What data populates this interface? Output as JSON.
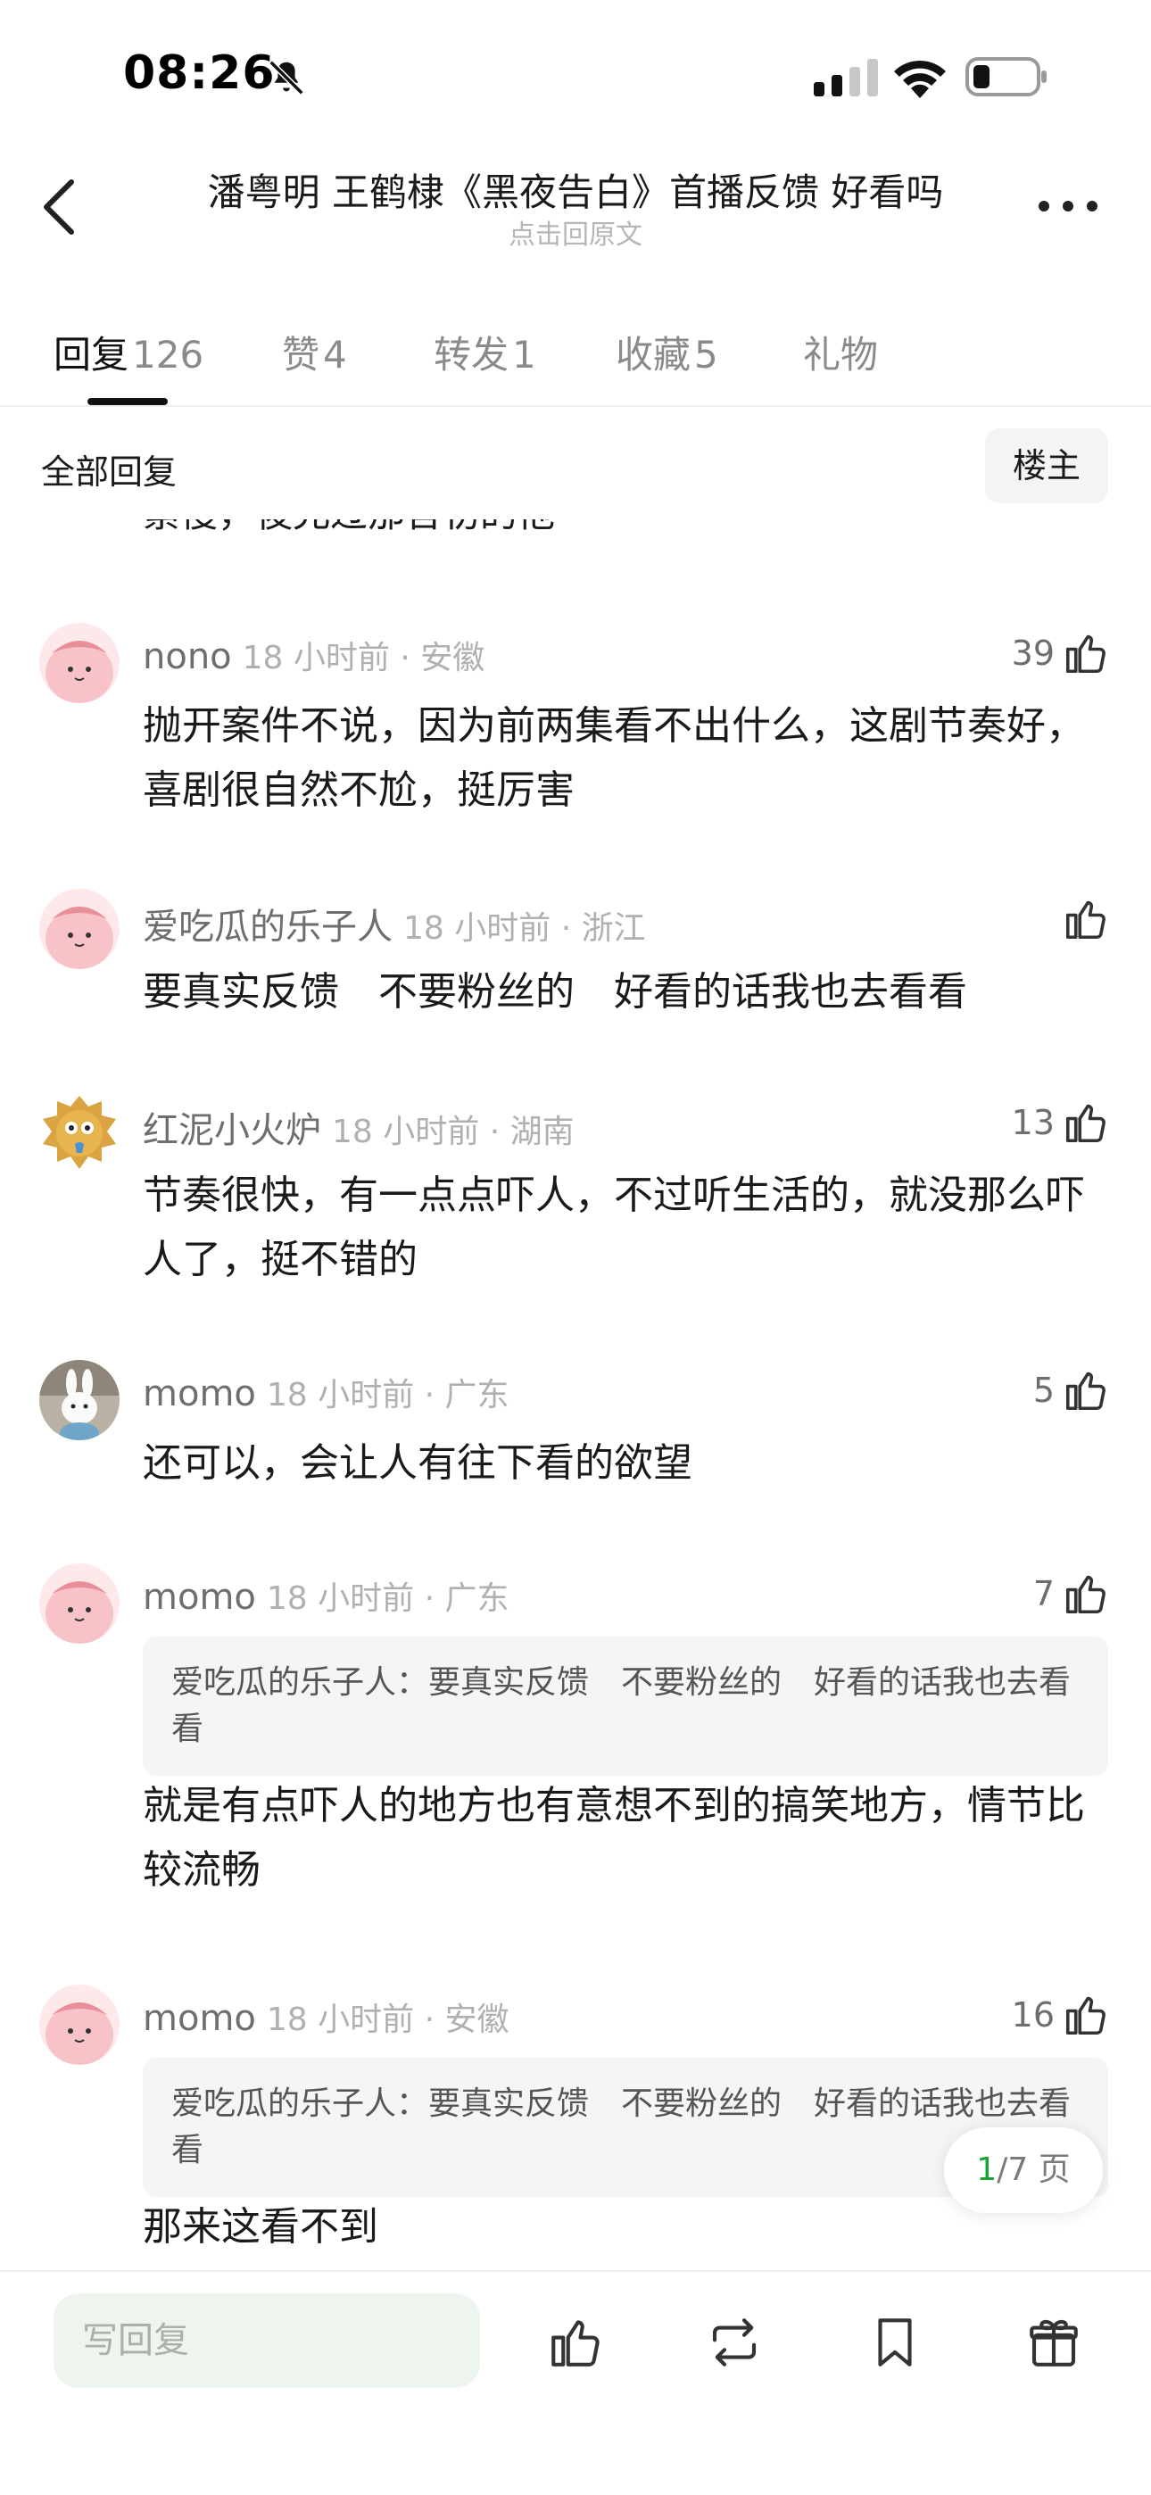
{
  "status": {
    "time": "08:26"
  },
  "nav": {
    "title": "潘粤明 王鹤棣《黑夜告白》首播反馈 好看吗",
    "subtitle": "点击回原文"
  },
  "tabs": [
    {
      "label": "回复",
      "count": "126"
    },
    {
      "label": "赞",
      "count": "4"
    },
    {
      "label": "转发",
      "count": "1"
    },
    {
      "label": "收藏",
      "count": "5"
    },
    {
      "label": "礼物",
      "count": ""
    }
  ],
  "filter": {
    "label": "全部回复",
    "owner_button": "楼主"
  },
  "cut_text": "累慢，後允过那舍初的他",
  "comments": [
    {
      "name": "nono",
      "meta": "18 小时前 · 安徽",
      "likes": "39",
      "quote": "",
      "body": "抛开案件不说，因为前两集看不出什么，这剧节奏好，喜剧很自然不尬，挺厉害",
      "avatar": "pink-cartoon"
    },
    {
      "name": "爱吃瓜的乐子人",
      "meta": "18 小时前 · 浙江",
      "likes": "",
      "quote": "",
      "body": "要真实反馈　不要粉丝的　好看的话我也去看看",
      "avatar": "pink-cartoon"
    },
    {
      "name": "红泥小火炉",
      "meta": "18 小时前 · 湖南",
      "likes": "13",
      "quote": "",
      "body": "节奏很快，有一点点吓人，不过听生活的，就没那么吓人了，挺不错的",
      "avatar": "yellow-cartoon"
    },
    {
      "name": "momo",
      "meta": "18 小时前 · 广东",
      "likes": "5",
      "quote": "",
      "body": "还可以，会让人有往下看的欲望",
      "avatar": "bunny-photo"
    },
    {
      "name": "momo",
      "meta": "18 小时前 · 广东",
      "likes": "7",
      "quote": "爱吃瓜的乐子人：要真实反馈　不要粉丝的　好看的话我也去看看",
      "body": "就是有点吓人的地方也有意想不到的搞笑地方，情节比较流畅",
      "avatar": "pink-cartoon"
    },
    {
      "name": "momo",
      "meta": "18 小时前 · 安徽",
      "likes": "16",
      "quote": "爱吃瓜的乐子人：要真实反馈　不要粉丝的　好看的话我也去看看",
      "body": "那来这看不到",
      "avatar": "pink-cartoon"
    }
  ],
  "pager": {
    "current": "1",
    "total": "/7 页"
  },
  "bottom": {
    "reply_placeholder": "写回复"
  },
  "colors": {
    "accent_green": "#1aa33a",
    "pink_avatar": "#f7c3c8",
    "input_bg": "#eef5ef"
  }
}
